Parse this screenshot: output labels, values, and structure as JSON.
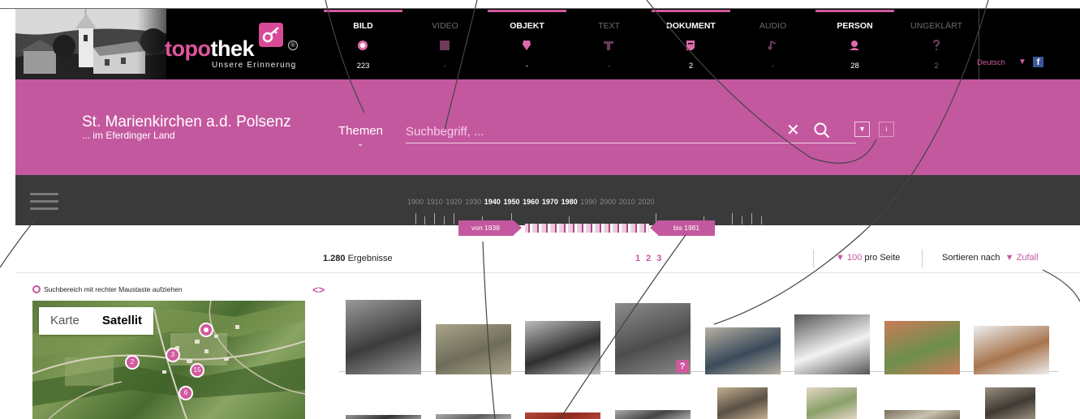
{
  "header": {
    "logo_word_a": "topo",
    "logo_word_b": "thek",
    "logo_reg": "®",
    "logo_subtitle": "Unsere Erinnerung",
    "categories": [
      {
        "label": "BILD",
        "count": "223",
        "active": true,
        "icon": "camera-icon"
      },
      {
        "label": "VIDEO",
        "count": "-",
        "active": false,
        "icon": "film-icon"
      },
      {
        "label": "OBJEKT",
        "count": "-",
        "active": true,
        "icon": "vase-icon"
      },
      {
        "label": "TEXT",
        "count": "-",
        "active": false,
        "icon": "text-icon"
      },
      {
        "label": "DOKUMENT",
        "count": "2",
        "active": true,
        "icon": "document-icon"
      },
      {
        "label": "AUDIO",
        "count": "-",
        "active": false,
        "icon": "note-icon"
      },
      {
        "label": "PERSON",
        "count": "28",
        "active": true,
        "icon": "person-icon"
      },
      {
        "label": "UNGEKLÄRT",
        "count": "2",
        "active": false,
        "icon": "question-icon"
      }
    ],
    "language": "Deutsch",
    "facebook": "f"
  },
  "band": {
    "place_title": "St. Marienkirchen a.d. Polsenz",
    "place_subtitle": "... im Eferdinger Land",
    "themes_label": "Themen",
    "search_placeholder": "Suchbegriff, ...",
    "info_label": "i"
  },
  "timeline": {
    "years": [
      "1900",
      "1910",
      "1920",
      "1930",
      "1940",
      "1950",
      "1960",
      "1970",
      "1980",
      "1990",
      "2000",
      "2010",
      "2020"
    ],
    "active_years": [
      "1940",
      "1950",
      "1960",
      "1970",
      "1980"
    ],
    "from_label": "von 1938",
    "to_label": "bis 1981"
  },
  "results": {
    "count": "1.280",
    "count_label": "Ergebnisse",
    "pages": [
      "1",
      "2",
      "3"
    ],
    "per_page_value": "100",
    "per_page_label": "pro Seite",
    "sort_label": "Sortieren nach",
    "sort_value": "Zufall"
  },
  "map": {
    "hint": "Suchbereich mit rechter Maustaste aufziehen",
    "type_map": "Karte",
    "type_satellite": "Satellit",
    "markers": [
      "2",
      "3",
      "15",
      "6"
    ],
    "collapse": "<>"
  },
  "thumbs": {
    "badge": "?"
  },
  "colors": {
    "accent": "#c4589f",
    "header_bg": "#000000",
    "timeline_bg": "#3a3a3a",
    "facebook": "#3b5998"
  }
}
